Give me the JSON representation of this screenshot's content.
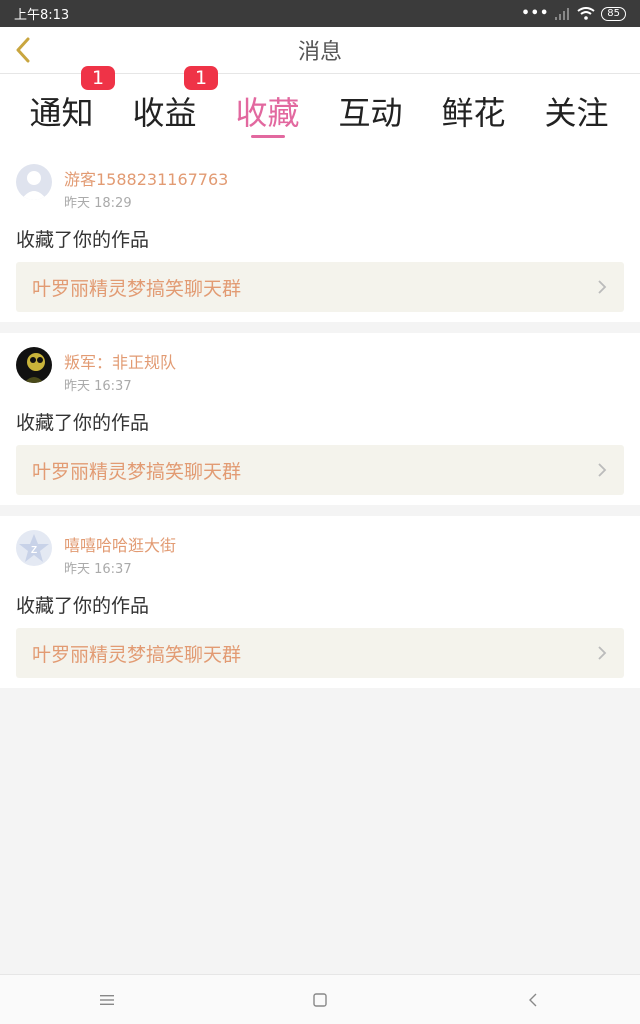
{
  "status_bar": {
    "time": "上午8:13",
    "battery": "85"
  },
  "header": {
    "title": "消息"
  },
  "tabs": [
    {
      "label": "通知",
      "badge": "1"
    },
    {
      "label": "收益",
      "badge": "1"
    },
    {
      "label": "收藏",
      "badge": ""
    },
    {
      "label": "互动",
      "badge": ""
    },
    {
      "label": "鲜花",
      "badge": ""
    },
    {
      "label": "关注",
      "badge": ""
    }
  ],
  "active_tab": "收藏",
  "messages": [
    {
      "user": "游客1588231167763",
      "time": "昨天 18:29",
      "action": "收藏了你的作品",
      "work": "叶罗丽精灵梦搞笑聊天群"
    },
    {
      "user": "叛军：非正规队",
      "time": "昨天 16:37",
      "action": "收藏了你的作品",
      "work": "叶罗丽精灵梦搞笑聊天群"
    },
    {
      "user": "嘻嘻哈哈逛大街",
      "time": "昨天 16:37",
      "action": "收藏了你的作品",
      "work": "叶罗丽精灵梦搞笑聊天群"
    }
  ],
  "colors": {
    "accent": "#e2689f",
    "username": "#e29b73",
    "badge": "#ef3347"
  }
}
